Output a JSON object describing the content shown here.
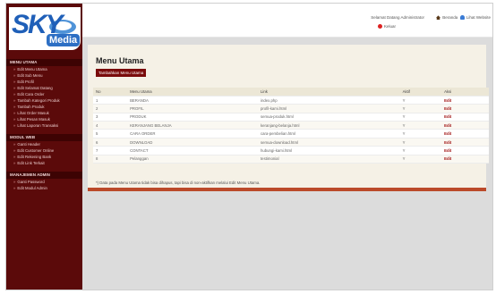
{
  "logo": {
    "sky": "SKY",
    "media": "Media"
  },
  "header": {
    "welcome": "Selamat Datang Administrator",
    "links": [
      "Beranda",
      "Lihat Website"
    ],
    "logout": "Keluar"
  },
  "sidebar": {
    "sections": [
      {
        "title": "MENU UTAMA",
        "items": [
          "Edit Menu Utama",
          "Edit Sub Menu",
          "Edit Profil",
          "Edit Selamat Datang",
          "Edit Cara Order",
          "Tambah Kategori Produk",
          "Tambah Produk",
          "Lihat Order Masuk",
          "Lihat Pesan Masuk",
          "Lihat Laporan Transaksi"
        ]
      },
      {
        "title": "MODUL WEB",
        "items": [
          "Ganti Header",
          "Edit Customer Online",
          "Edit Rekening Bank",
          "Edit Link Terkait"
        ]
      },
      {
        "title": "MANAJEMEN ADMIN",
        "items": [
          "Ganti Password",
          "Edit Modul Admin"
        ]
      }
    ]
  },
  "main": {
    "title": "Menu Utama",
    "add_button": "Tambahkan Menu Utama",
    "columns": [
      "No",
      "Menu Utama",
      "Link",
      "Aktif",
      "Aksi"
    ],
    "rows": [
      [
        "1",
        "BERANDA",
        "index.php",
        "Y",
        "Edit"
      ],
      [
        "2",
        "PROFIL",
        "profil-kami.html",
        "Y",
        "Edit"
      ],
      [
        "3",
        "PRODUK",
        "semua-produk.html",
        "Y",
        "Edit"
      ],
      [
        "4",
        "KERANJANG BELANJA",
        "keranjang-belanja.html",
        "Y",
        "Edit"
      ],
      [
        "5",
        "CARA ORDER",
        "cara-pembelian.html",
        "Y",
        "Edit"
      ],
      [
        "6",
        "DOWNLOAD",
        "semua-download.html",
        "Y",
        "Edit"
      ],
      [
        "7",
        "CONTACT",
        "hubungi-kami.html",
        "Y",
        "Edit"
      ],
      [
        "8",
        "Pelanggan",
        "testimonial",
        "Y",
        "Edit"
      ]
    ],
    "note": "*) Data pada Menu Utama tidak bisa dihapus, tapi bisa di non-aktifkan melalui Edit Menu Utama."
  },
  "colors": {
    "sidebar_bg": "#5b0a0a",
    "accent": "#7a0b0b",
    "logo_blue": "#1f5fb8"
  }
}
